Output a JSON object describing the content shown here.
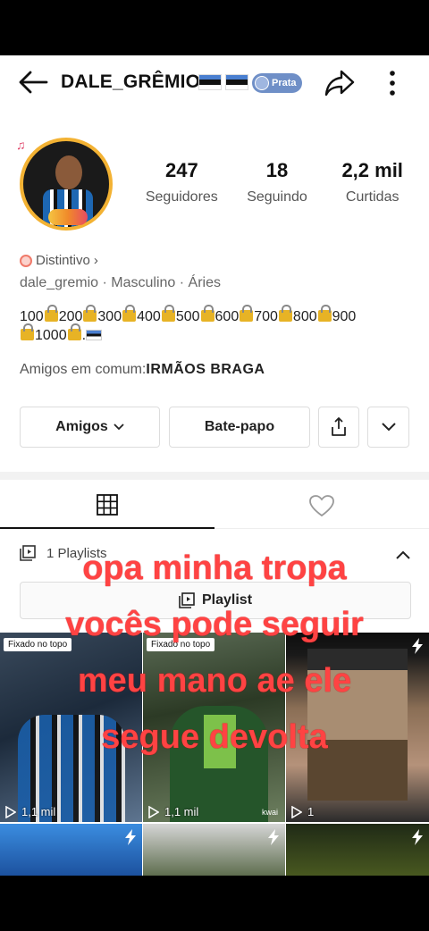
{
  "header": {
    "username": "DALE_GRÊMIO",
    "badge": "Prata"
  },
  "profile": {
    "stats": [
      {
        "value": "247",
        "label": "Seguidores"
      },
      {
        "value": "18",
        "label": "Seguindo"
      },
      {
        "value": "2,2 mil",
        "label": "Curtidas"
      }
    ],
    "distintivo": "Distintivo",
    "meta": "dale_gremio  ·  Masculino  ·  Áries",
    "bio_numbers": [
      "100",
      "200",
      "300",
      "400",
      "500",
      "600",
      "700",
      "800",
      "900",
      "1000"
    ],
    "mutual_prefix": "Amigos em comum:",
    "mutual_names": "IRMÃOS  BRAGA"
  },
  "actions": {
    "friends_label": "Amigos",
    "chat_label": "Bate-papo"
  },
  "playlist": {
    "count_label": "1 Playlists",
    "button_label": "Playlist"
  },
  "grid": {
    "pinned_label": "Fixado no topo",
    "items": [
      {
        "views": "1,1 mil",
        "pinned": true
      },
      {
        "views": "1,1 mil",
        "pinned": true,
        "watermark": "kwai"
      },
      {
        "views": "1"
      }
    ]
  },
  "overlay_text": [
    "opa minha tropa",
    "vocês pode seguir",
    "meu mano ae ele",
    "segue devolta"
  ],
  "colors": {
    "overlay": "#ff4343",
    "badge": "#6f8fc7",
    "avatar_ring": "#f3b233"
  }
}
